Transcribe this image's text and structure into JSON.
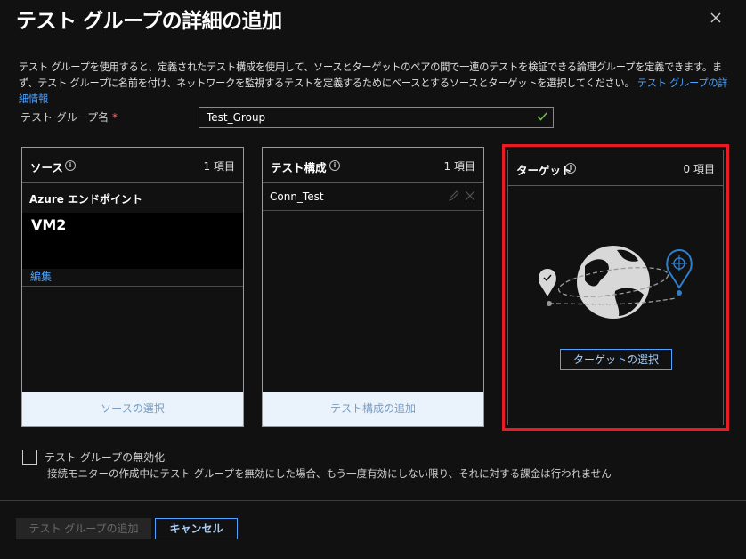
{
  "header": {
    "title": "テスト グループの詳細の追加"
  },
  "description": {
    "text": "テスト グループを使用すると、定義されたテスト構成を使用して、ソースとターゲットのペアの間で一連のテストを検証できる論理グループを定義できます。まず、テスト グループに名前を付け、ネットワークを監視するテストを定義するためにベースとするソースとターゲットを選択してください。",
    "link": "テスト グループの詳細情報"
  },
  "group_name": {
    "label": "テスト グループ名",
    "required_mark": "*",
    "value": "Test_Group"
  },
  "source_panel": {
    "title": "ソース",
    "count": "1 項目",
    "type_label": "Azure エンドポイント",
    "item": "VM2",
    "edit_link": "編集",
    "footer_button": "ソースの選択"
  },
  "config_panel": {
    "title": "テスト構成",
    "count": "1 項目",
    "item": "Conn_Test",
    "footer_button": "テスト構成の追加"
  },
  "target_panel": {
    "title": "ターゲット",
    "count": "0 項目",
    "select_button": "ターゲットの選択"
  },
  "disable_option": {
    "label": "テスト グループの無効化",
    "description": "接続モニターの作成中にテスト グループを無効にした場合、もう一度有効にしない限り、それに対する課金は行われません",
    "checked": false
  },
  "footer": {
    "add_button": "テスト グループの追加",
    "cancel_button": "キャンセル"
  },
  "colors": {
    "accent": "#4fa3ff",
    "highlight": "#e81c24",
    "valid": "#6cc24a"
  },
  "icons": [
    "close-icon",
    "info-icon",
    "checkmark-icon",
    "pencil-icon",
    "delete-icon",
    "globe-icon",
    "location-pin-icon",
    "target-pin-icon"
  ]
}
